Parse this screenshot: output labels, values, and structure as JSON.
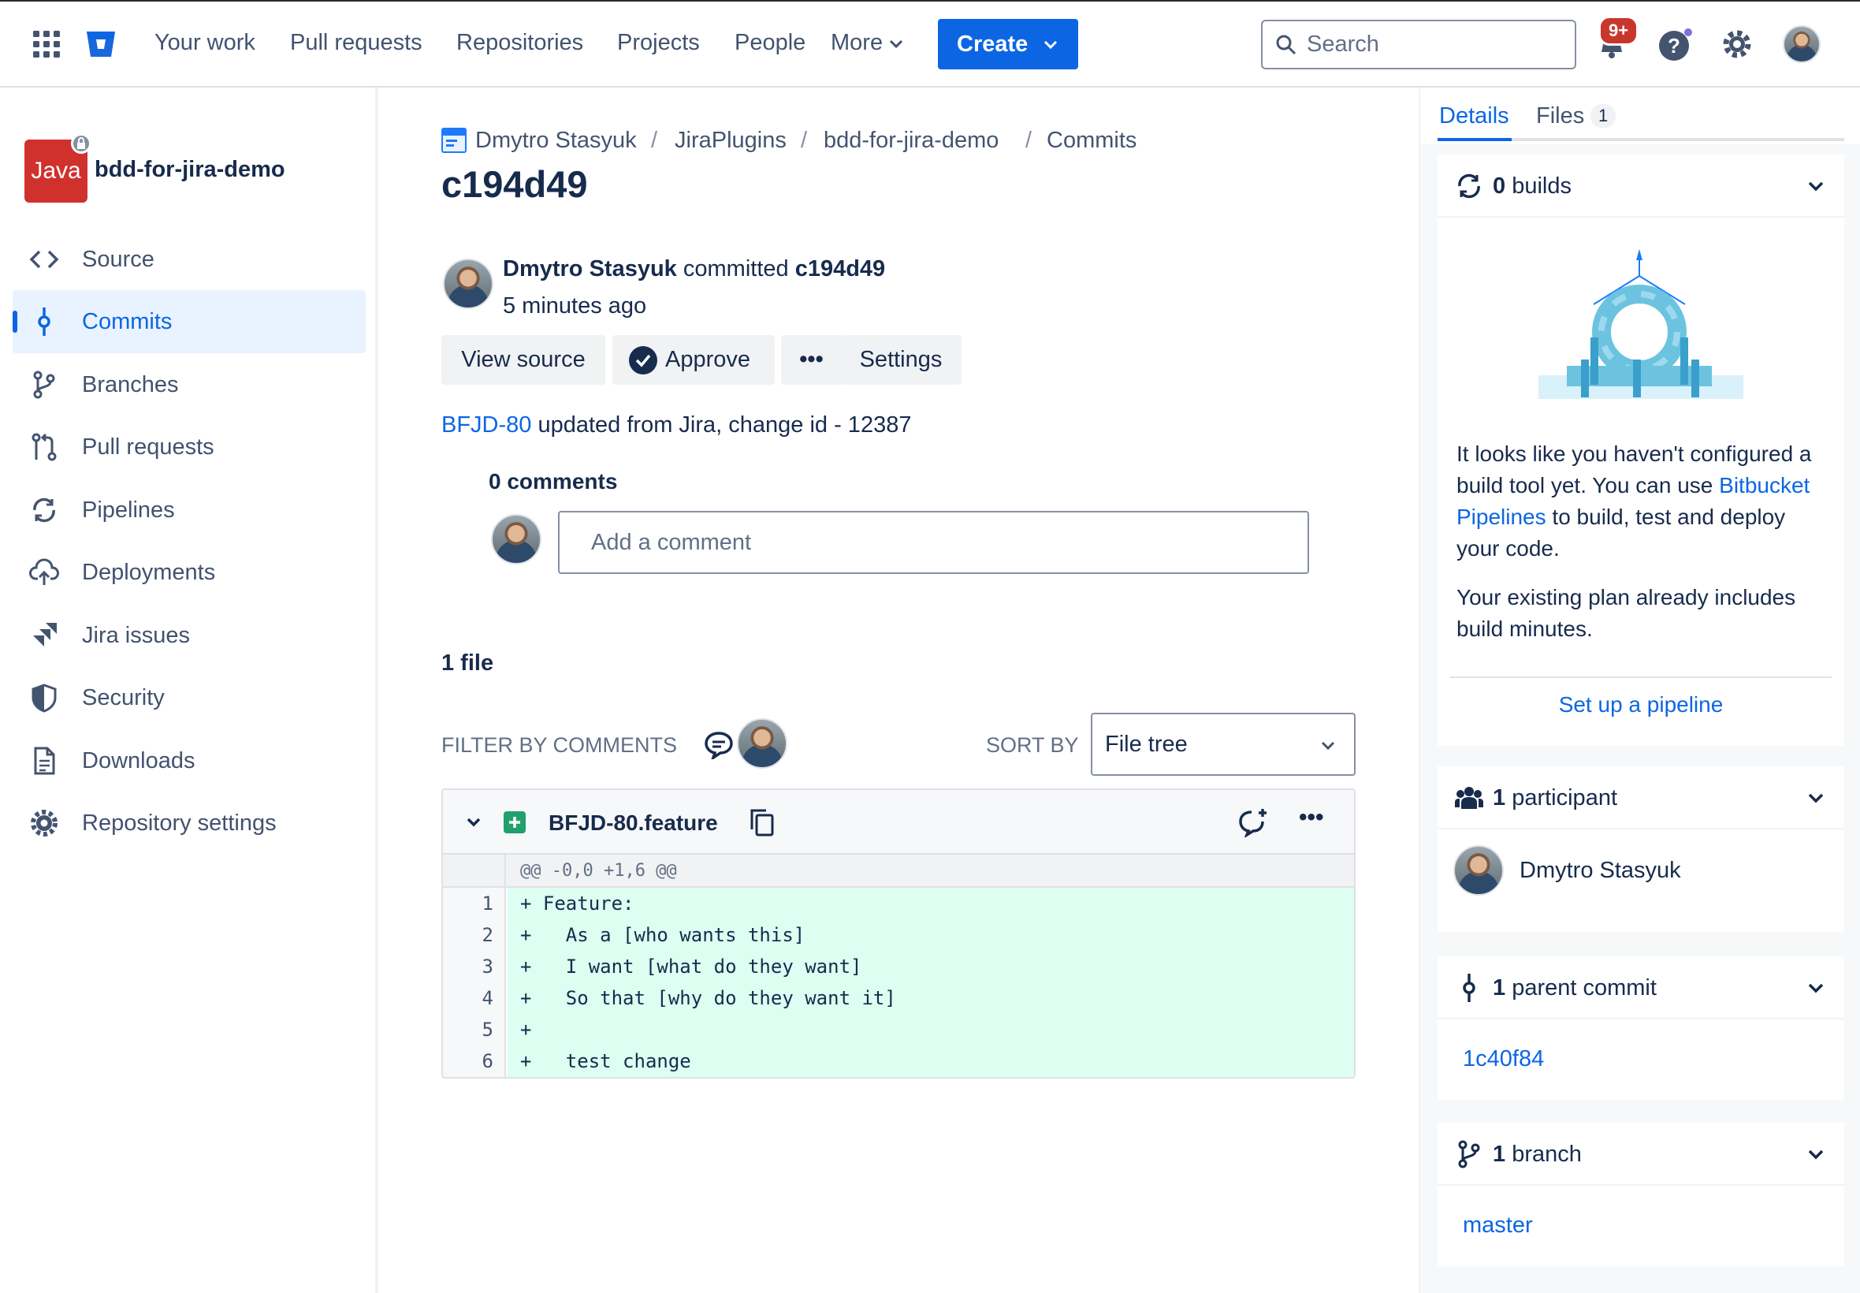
{
  "nav": {
    "links": [
      "Your work",
      "Pull requests",
      "Repositories",
      "Projects",
      "People",
      "More"
    ],
    "create_label": "Create",
    "search_placeholder": "Search",
    "notifications_badge": "9+"
  },
  "sidebar": {
    "repo_logo_text": "Java",
    "repo_name": "bdd-for-jira-demo",
    "items": [
      {
        "label": "Source",
        "icon": "code-icon"
      },
      {
        "label": "Commits",
        "icon": "commit-icon",
        "active": true
      },
      {
        "label": "Branches",
        "icon": "branch-icon"
      },
      {
        "label": "Pull requests",
        "icon": "pull-request-icon"
      },
      {
        "label": "Pipelines",
        "icon": "pipelines-icon"
      },
      {
        "label": "Deployments",
        "icon": "cloud-upload-icon"
      },
      {
        "label": "Jira issues",
        "icon": "jira-icon"
      },
      {
        "label": "Security",
        "icon": "shield-icon"
      },
      {
        "label": "Downloads",
        "icon": "file-icon"
      },
      {
        "label": "Repository settings",
        "icon": "gear-icon"
      }
    ]
  },
  "main": {
    "breadcrumb": [
      "Dmytro Stasyuk",
      "JiraPlugins",
      "bdd-for-jira-demo",
      "Commits"
    ],
    "commit_hash": "c194d49",
    "author": "Dmytro Stasyuk",
    "committed_word": "committed",
    "time_ago": "5 minutes ago",
    "buttons": {
      "view_source": "View source",
      "approve": "Approve",
      "more": "•••",
      "settings": "Settings"
    },
    "message_link": "BFJD-80",
    "message_rest": "updated from Jira, change id - 12387",
    "comments_title": "0 comments",
    "comment_placeholder": "Add a comment",
    "files_count": "1 file",
    "filter_label": "FILTER BY COMMENTS",
    "sort_label": "SORT BY",
    "sort_value": "File tree",
    "diff": {
      "file_name": "BFJD-80.feature",
      "hunk": "@@ -0,0 +1,6 @@",
      "lines": [
        {
          "n": "1",
          "code": "+ Feature:"
        },
        {
          "n": "2",
          "code": "+   As a [who wants this]"
        },
        {
          "n": "3",
          "code": "+   I want [what do they want]"
        },
        {
          "n": "4",
          "code": "+   So that [why do they want it]"
        },
        {
          "n": "5",
          "code": "+"
        },
        {
          "n": "6",
          "code": "+   test change"
        }
      ]
    }
  },
  "right": {
    "tabs": {
      "details": "Details",
      "files": "Files",
      "files_count": "1"
    },
    "builds": {
      "count": "0",
      "label": "builds"
    },
    "builds_text_1": "It looks like you haven't configured a build tool yet. You can use",
    "builds_link": "Bitbucket Pipelines",
    "builds_text_2": "to build, test and deploy your code.",
    "builds_text_3": "Your existing plan already includes build minutes.",
    "setup_link": "Set up a pipeline",
    "participants": {
      "count": "1",
      "label": "participant",
      "name": "Dmytro Stasyuk"
    },
    "parent": {
      "count": "1",
      "label": "parent commit",
      "hash": "1c40f84"
    },
    "branch": {
      "count": "1",
      "label": "branch",
      "name": "master"
    }
  },
  "colors": {
    "brand": "#0c66e4",
    "added_bg": "#dcfff1",
    "java_red": "#d0312d"
  }
}
